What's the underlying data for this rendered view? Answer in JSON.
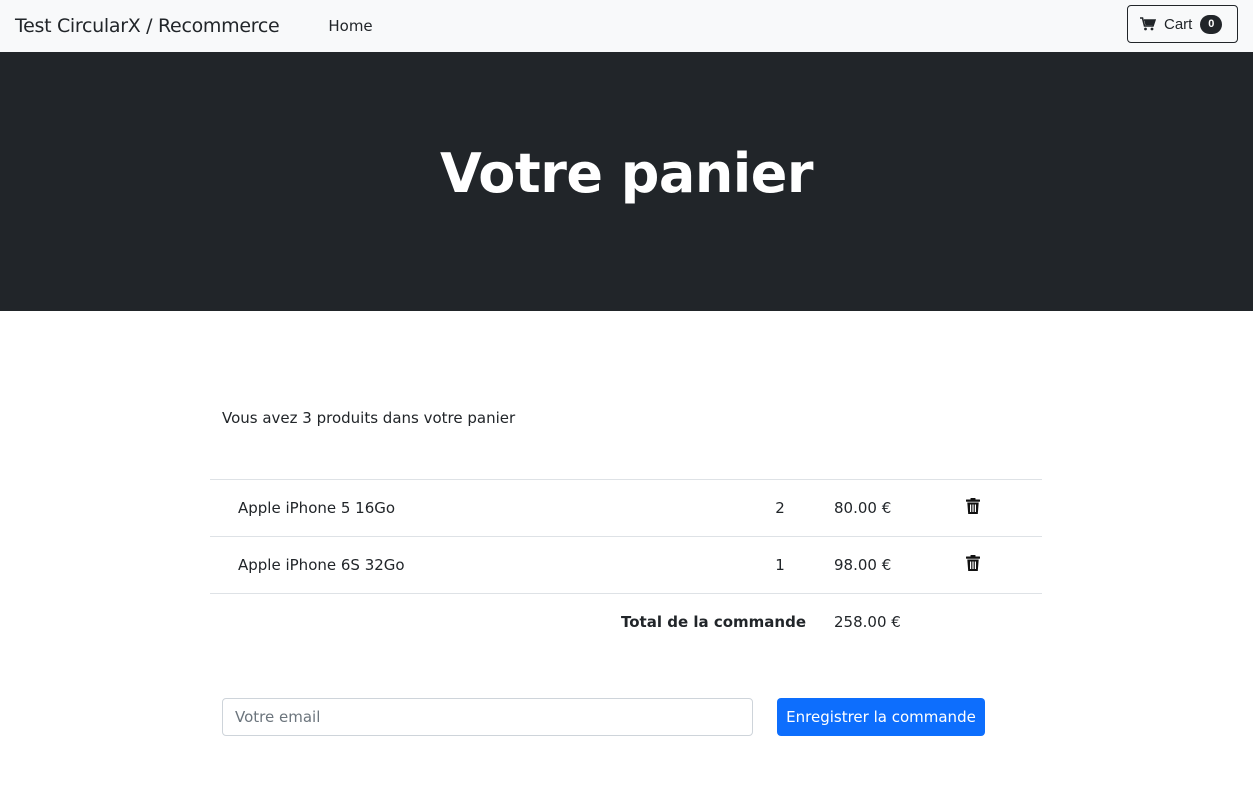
{
  "navbar": {
    "brand": "Test CircularX / Recommerce",
    "home_label": "Home",
    "cart": {
      "label": "Cart",
      "count": "0",
      "icon": "cart-icon"
    }
  },
  "hero": {
    "title": "Votre panier"
  },
  "summary": "Vous avez 3 produits dans votre panier",
  "cart_items": [
    {
      "name": "Apple iPhone 5 16Go",
      "qty": "2",
      "price": "80.00 €",
      "delete_icon": "trash-icon"
    },
    {
      "name": "Apple iPhone 6S 32Go",
      "qty": "1",
      "price": "98.00 €",
      "delete_icon": "trash-icon"
    }
  ],
  "total": {
    "label": "Total de la commande",
    "value": "258.00 €"
  },
  "form": {
    "email_placeholder": "Votre email",
    "email_value": "",
    "submit_label": "Enregistrer la commande"
  },
  "colors": {
    "navbar_bg": "#f8f9fa",
    "hero_bg": "#212529",
    "primary": "#0d6efd",
    "text": "#212529"
  }
}
